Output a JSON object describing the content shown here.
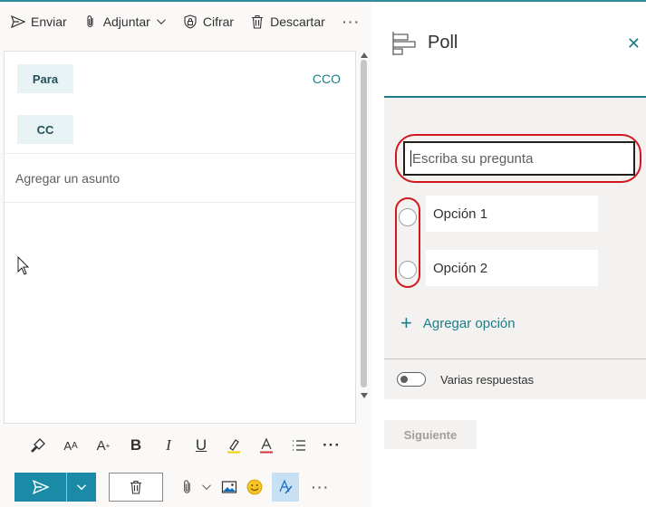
{
  "toolbar": {
    "send_label": "Enviar",
    "attach_label": "Adjuntar",
    "encrypt_label": "Cifrar",
    "discard_label": "Descartar",
    "more_label": "···"
  },
  "compose": {
    "to_label": "Para",
    "bcc_label": "CCO",
    "cc_label": "CC",
    "subject_placeholder": "Agregar un asunto"
  },
  "format_bar": {
    "icons": [
      "format-painter-icon",
      "font-size-icon",
      "font-grow-icon",
      "bold-icon",
      "italic-icon",
      "underline-icon",
      "highlight-icon",
      "font-color-icon",
      "bullets-icon",
      "more-icon"
    ],
    "bold": "B",
    "italic": "I",
    "underline": "U",
    "font_size": "A",
    "more": "···"
  },
  "action_bar": {
    "more": "···"
  },
  "poll": {
    "title": "Poll",
    "close": "✕",
    "question_placeholder": "Escriba su pregunta",
    "options": [
      "Opción 1",
      "Opción 2"
    ],
    "add_option": "Agregar opción",
    "multiple_answers": "Varias respuestas",
    "next": "Siguiente"
  },
  "colors": {
    "accent": "#1b7d86",
    "send_button": "#1a8ba6",
    "annotation_red": "#d1181c"
  }
}
